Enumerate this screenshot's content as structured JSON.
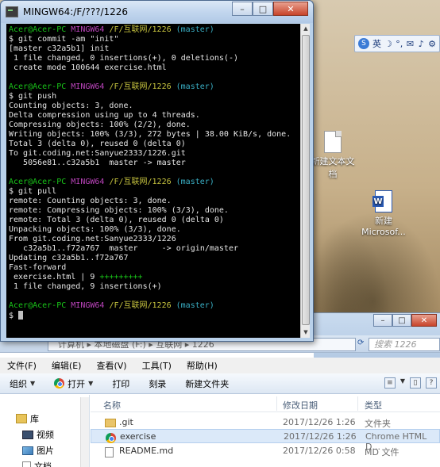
{
  "terminal": {
    "title": "MINGW64:/F/???/1226",
    "controls": {
      "minimize": "–",
      "maximize": "□",
      "close": "✕"
    },
    "lines": [
      {
        "parts": [
          {
            "t": "Acer@Acer-PC ",
            "c": "green"
          },
          {
            "t": "MINGW64 ",
            "c": "magenta"
          },
          {
            "t": "/F/互联网/1226 ",
            "c": "yellow"
          },
          {
            "t": "(master)",
            "c": "cyan"
          }
        ]
      },
      {
        "parts": [
          {
            "t": "$ git commit -am \"init\"",
            "c": "white"
          }
        ]
      },
      {
        "parts": [
          {
            "t": "[master c32a5b1] init",
            "c": "white"
          }
        ]
      },
      {
        "parts": [
          {
            "t": " 1 file changed, 0 insertions(+), 0 deletions(-)",
            "c": "white"
          }
        ]
      },
      {
        "parts": [
          {
            "t": " create mode 100644 exercise.html",
            "c": "white"
          }
        ]
      },
      {
        "parts": [
          {
            "t": "",
            "c": "white"
          }
        ]
      },
      {
        "parts": [
          {
            "t": "Acer@Acer-PC ",
            "c": "green"
          },
          {
            "t": "MINGW64 ",
            "c": "magenta"
          },
          {
            "t": "/F/互联网/1226 ",
            "c": "yellow"
          },
          {
            "t": "(master)",
            "c": "cyan"
          }
        ]
      },
      {
        "parts": [
          {
            "t": "$ git push",
            "c": "white"
          }
        ]
      },
      {
        "parts": [
          {
            "t": "Counting objects: 3, done.",
            "c": "white"
          }
        ]
      },
      {
        "parts": [
          {
            "t": "Delta compression using up to 4 threads.",
            "c": "white"
          }
        ]
      },
      {
        "parts": [
          {
            "t": "Compressing objects: 100% (2/2), done.",
            "c": "white"
          }
        ]
      },
      {
        "parts": [
          {
            "t": "Writing objects: 100% (3/3), 272 bytes | 38.00 KiB/s, done.",
            "c": "white"
          }
        ]
      },
      {
        "parts": [
          {
            "t": "Total 3 (delta 0), reused 0 (delta 0)",
            "c": "white"
          }
        ]
      },
      {
        "parts": [
          {
            "t": "To git.coding.net:Sanyue2333/1226.git",
            "c": "white"
          }
        ]
      },
      {
        "parts": [
          {
            "t": "   5056e81..c32a5b1  master -> master",
            "c": "white"
          }
        ]
      },
      {
        "parts": [
          {
            "t": "",
            "c": "white"
          }
        ]
      },
      {
        "parts": [
          {
            "t": "Acer@Acer-PC ",
            "c": "green"
          },
          {
            "t": "MINGW64 ",
            "c": "magenta"
          },
          {
            "t": "/F/互联网/1226 ",
            "c": "yellow"
          },
          {
            "t": "(master)",
            "c": "cyan"
          }
        ]
      },
      {
        "parts": [
          {
            "t": "$ git pull",
            "c": "white"
          }
        ]
      },
      {
        "parts": [
          {
            "t": "remote: Counting objects: 3, done.",
            "c": "white"
          }
        ]
      },
      {
        "parts": [
          {
            "t": "remote: Compressing objects: 100% (3/3), done.",
            "c": "white"
          }
        ]
      },
      {
        "parts": [
          {
            "t": "remote: Total 3 (delta 0), reused 0 (delta 0)",
            "c": "white"
          }
        ]
      },
      {
        "parts": [
          {
            "t": "Unpacking objects: 100% (3/3), done.",
            "c": "white"
          }
        ]
      },
      {
        "parts": [
          {
            "t": "From git.coding.net:Sanyue2333/1226",
            "c": "white"
          }
        ]
      },
      {
        "parts": [
          {
            "t": "   c32a5b1..f72a767  master     -> origin/master",
            "c": "white"
          }
        ]
      },
      {
        "parts": [
          {
            "t": "Updating c32a5b1..f72a767",
            "c": "white"
          }
        ]
      },
      {
        "parts": [
          {
            "t": "Fast-forward",
            "c": "white"
          }
        ]
      },
      {
        "parts": [
          {
            "t": " exercise.html | 9 ",
            "c": "white"
          },
          {
            "t": "+++++++++",
            "c": "green"
          }
        ]
      },
      {
        "parts": [
          {
            "t": " 1 file changed, 9 insertions(+)",
            "c": "white"
          }
        ]
      },
      {
        "parts": [
          {
            "t": "",
            "c": "white"
          }
        ]
      },
      {
        "parts": [
          {
            "t": "Acer@Acer-PC ",
            "c": "green"
          },
          {
            "t": "MINGW64 ",
            "c": "magenta"
          },
          {
            "t": "/F/互联网/1226 ",
            "c": "yellow"
          },
          {
            "t": "(master)",
            "c": "cyan"
          }
        ]
      },
      {
        "parts": [
          {
            "t": "$ ",
            "c": "white"
          }
        ]
      }
    ]
  },
  "langbar": {
    "lang": "英",
    "items": [
      "☽",
      "°,",
      "✉",
      "♪",
      "⚙"
    ]
  },
  "desktop": {
    "icons": [
      {
        "label": "新建文本文档",
        "type": "text"
      },
      {
        "label": "新建 Microsof...",
        "type": "word"
      }
    ]
  },
  "explorer": {
    "address": "计算机 ▸ 本地磁盘 (F:) ▸ 互联网 ▸ 1226",
    "search_placeholder": "搜索 1226",
    "menu": [
      "文件(F)",
      "编辑(E)",
      "查看(V)",
      "工具(T)",
      "帮助(H)"
    ],
    "toolbar": {
      "organize": "组织",
      "open": "打开",
      "print": "打印",
      "burn": "刻录",
      "new_folder": "新建文件夹"
    },
    "nav": {
      "library": "库",
      "video": "视频",
      "pictures": "图片",
      "documents": "文档"
    },
    "columns": {
      "name": "名称",
      "modified": "修改日期",
      "type": "类型"
    },
    "files": [
      {
        "name": ".git",
        "date": "2017/12/26 1:26",
        "type": "文件夹",
        "icon": "folder-icon"
      },
      {
        "name": "exercise",
        "date": "2017/12/26 1:26",
        "type": "Chrome HTML D...",
        "icon": "chrome-icon"
      },
      {
        "name": "README.md",
        "date": "2017/12/26 0:58",
        "type": "MD 文件",
        "icon": "file-icon"
      }
    ],
    "colors": {
      "selection": "#dbe9f9",
      "title_bar": "#b9d1ea"
    }
  }
}
